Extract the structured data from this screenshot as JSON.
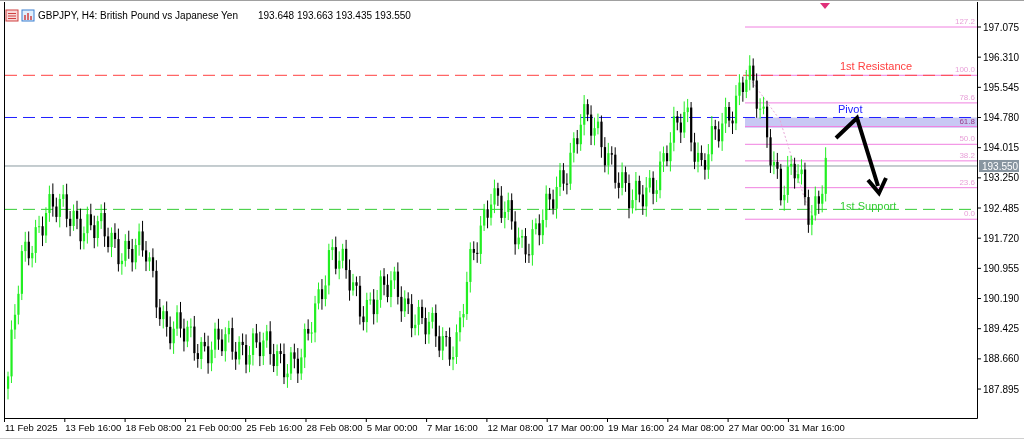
{
  "window": {
    "title": "GBPJPY, H4:  British Pound vs Japanese Yen",
    "quote": "193.648 193.663 193.435 193.550"
  },
  "price_axis": {
    "labels": [
      "197.075",
      "196.310",
      "195.545",
      "194.780",
      "194.015",
      "193.250",
      "192.485",
      "191.720",
      "190.955",
      "190.190",
      "189.425",
      "188.660",
      "187.895"
    ],
    "current_price": "193.550"
  },
  "time_axis": {
    "labels": [
      "11 Feb 2025",
      "13 Feb 16:00",
      "18 Feb 08:00",
      "21 Feb 00:00",
      "25 Feb 16:00",
      "28 Feb 08:00",
      "5 Mar 00:00",
      "7 Mar 16:00",
      "12 Mar 08:00",
      "17 Mar 00:00",
      "19 Mar 16:00",
      "24 Mar 08:00",
      "27 Mar 00:00",
      "31 Mar 16:00"
    ]
  },
  "levels": [
    {
      "label": "1st Resistance",
      "color": "#ff4040"
    },
    {
      "label": "Pivot",
      "color": "#2020ff"
    },
    {
      "label": "1st Support",
      "color": "#33cc33"
    }
  ],
  "fibonacci": {
    "levels": [
      "127.2",
      "100.0",
      "78.6",
      "61.8",
      "50.0",
      "38.2",
      "23.6",
      "0.0"
    ]
  }
}
